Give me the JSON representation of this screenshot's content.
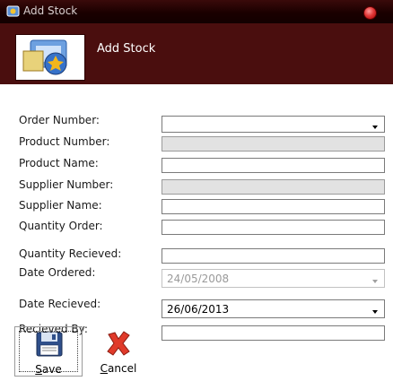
{
  "window": {
    "title": "Add Stock"
  },
  "header": {
    "heading": "Add Stock"
  },
  "labels": {
    "order_number": "Order Number:",
    "product_number": "Product Number:",
    "product_name": "Product Name:",
    "supplier_number": "Supplier Number:",
    "supplier_name": "Supplier Name:",
    "quantity_order": "Quantity Order:",
    "quantity_received": "Quantity Recieved:",
    "date_ordered": "Date Ordered:",
    "date_received": "Date Recieved:",
    "received_by": "Recieved By:"
  },
  "fields": {
    "order_number": "",
    "product_number": "",
    "product_name": "",
    "supplier_number": "",
    "supplier_name": "",
    "quantity_order": "",
    "quantity_received": "",
    "date_ordered": "24/05/2008",
    "date_received": "26/06/2013",
    "received_by": ""
  },
  "buttons": {
    "save": {
      "mnemonic": "S",
      "rest": "ave"
    },
    "cancel": {
      "mnemonic": "C",
      "rest": "ancel"
    }
  },
  "icons": {
    "app": "app-icon",
    "header": "stock-logo-icon",
    "save": "floppy-disk-icon",
    "cancel": "red-x-icon",
    "close": "close-icon"
  }
}
